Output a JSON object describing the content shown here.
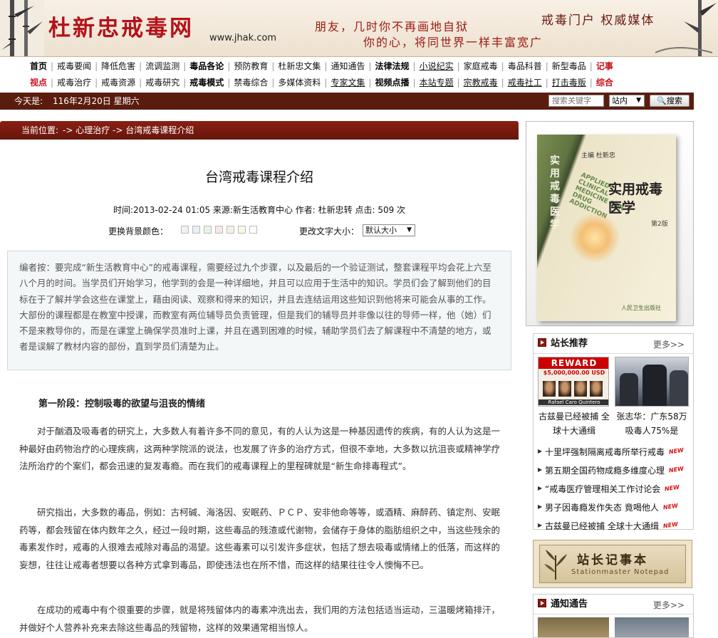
{
  "header": {
    "site_title": "杜新忠戒毒网",
    "url": "www.jhak.com",
    "slogan_line1": "朋友，几时你不再画地自狱",
    "slogan_line2": "你的心，将同世界一样丰富宽广",
    "tagline": "戒毒门户  权威媒体"
  },
  "nav": {
    "row1": [
      {
        "label": "首页",
        "style": "bold"
      },
      {
        "label": "戒毒要闻"
      },
      {
        "label": "降低危害"
      },
      {
        "label": "流调监测"
      },
      {
        "label": "毒品各论",
        "style": "bold"
      },
      {
        "label": "预防教育"
      },
      {
        "label": "杜新忠文集"
      },
      {
        "label": "通知通告"
      },
      {
        "label": "法律法规",
        "style": "bold"
      },
      {
        "label": "小说纪实",
        "style": "underline"
      },
      {
        "label": "家庭戒毒"
      },
      {
        "label": "毒品科普"
      },
      {
        "label": "新型毒品"
      },
      {
        "label": "记事",
        "style": "red"
      }
    ],
    "row2": [
      {
        "label": "视点",
        "style": "red"
      },
      {
        "label": "戒毒治疗"
      },
      {
        "label": "戒毒资源"
      },
      {
        "label": "戒毒研究"
      },
      {
        "label": "戒毒模式",
        "style": "bold"
      },
      {
        "label": "禁毒综合"
      },
      {
        "label": "多媒体资料"
      },
      {
        "label": "专家文集",
        "style": "underline"
      },
      {
        "label": "视频点播",
        "style": "bold"
      },
      {
        "label": "本站专题",
        "style": "underline"
      },
      {
        "label": "宗教戒毒",
        "style": "underline"
      },
      {
        "label": "戒毒社工",
        "style": "underline"
      },
      {
        "label": "打击毒贩",
        "style": "underline"
      },
      {
        "label": "综合",
        "style": "red"
      }
    ]
  },
  "datebar": {
    "label": "今天是:",
    "date": "116年2月20日 星期六",
    "search_placeholder": "搜索关键字",
    "scope": "站内",
    "search_button": "搜索"
  },
  "breadcrumb": {
    "label": "当前位置:",
    "path": "-> 心理治疗 -> 台湾戒毒课程介绍"
  },
  "article": {
    "title": "台湾戒毒课程介绍",
    "meta": "时间:2013-02-24 01:05 来源:新生活教育中心 作者: 杜新忠转 点击: 509 次",
    "bg_color_label": "更换背景颜色：",
    "bg_swatches": [
      "#eef3f8",
      "#e8f0f8",
      "#e8f4e8",
      "#fbe6e6",
      "#f8f0e4",
      "#f8f8e4",
      "#ffffff"
    ],
    "font_size_label": "更改文字大小：",
    "font_size_value": "默认大小",
    "editor_note": "编者按：要完成“新生活教育中心”的戒毒课程，需要经过九个步骤，以及最后的一个验证测试，整套课程平均会花上六至八个月的时间。当学员们开始学习，他学到的会是一种详细地，并且可以应用于生活中的知识。学员们会了解到他们的目标在于了解并学会这些在课堂上，藉由阅读、观察和得来的知识，并且去连结运用这些知识到他将来可能会从事的工作。大部份的课程都是在教室中授课，而教室有两位辅导员负责管理，但是我们的辅导员并非像以往的导师一样，他（她）们不是来教导你的，而是在课堂上确保学员准时上课，并且在遇到困难的时候，辅助学员们去了解课程中不清楚的地方，或者是误解了教材内容的部份，直到学员们清楚为止。",
    "section1_heading": "第一阶段：控制吸毒的欲望与沮丧的情绪",
    "para1": "对于酗酒及吸毒者的研究上，大多数人有着许多不同的意见，有的人认为这是一种基因遗传的疾病，有的人认为这是一种最好由药物治疗的心理疾病，这两种学院派的说法，也发展了许多的治疗方式，但很不幸地，大多数以抗沮丧或精神学疗法所治疗的个案们，都会迅速的复发毒瘾。而在我们的戒毒课程上的里程碑就是“新生命排毒程式”。",
    "para2": "研究指出，大多数的毒品，例如：古柯碱、海洛因、安眠药、ＰＣＰ、安非他命等等，或酒精、麻醉药、镇定剂、安眠药等，都会残留在体内数年之久，经过一段时期，这些毒品的残渣或代谢物，会储存于身体的脂肪组织之中，当这些残余的毒素发作时，戒毒的人很难去戒除对毒品的渴望。这些毒素可以引发许多症状，包括了想去吸毒或情绪上的低落，而这样的妄想，往往让戒毒者想要以各种方式拿到毒品，即使违法也在所不惜，而这样的结果往往令人懊悔不已。",
    "para3": "在成功的戒毒中有个很重要的步骤，就是将残留体内的毒素冲洗出去，我们用的方法包括适当运动，三温暖烤箱排汗，并做好个人营养补充来去除这些毒品的残留物，这样的效果通常相当惊人。"
  },
  "sidebar": {
    "book": {
      "author": "主编  杜新忠",
      "vertical_title": "实用戒毒医学",
      "english_title": "APPLIED CLINICAL MEDICINE FOR DRUG ADDICTION",
      "title": "实用戒毒医学",
      "edition": "第2版",
      "publisher": "人民卫生出版社"
    },
    "recommend": {
      "title": "站长推荐",
      "more": "更多>>",
      "reward_title": "REWARD",
      "reward_amount": "$5,000,000.00 USD",
      "reward_name": "Rafael Caro Quintero",
      "caption1": "古兹曼已经被捕 全球十大通缉",
      "caption2": "张志华：广东58万吸毒人75%是",
      "items": [
        {
          "text": "十里坪强制隔离戒毒所举行戒毒"
        },
        {
          "text": "第五期全国药物成瘾多维度心理"
        },
        {
          "text": "“戒毒医疗管理相关工作讨论会"
        },
        {
          "text": "男子因毒瘾发作失态 竟喝他人"
        },
        {
          "text": "古兹曼已经被捕 全球十大通缉"
        }
      ],
      "new_tag": "NEW"
    },
    "notepad": {
      "title": "站长记事本",
      "subtitle": "Stationmaster Notepad"
    },
    "notice": {
      "title": "通知通告",
      "more": "更多>>"
    }
  }
}
